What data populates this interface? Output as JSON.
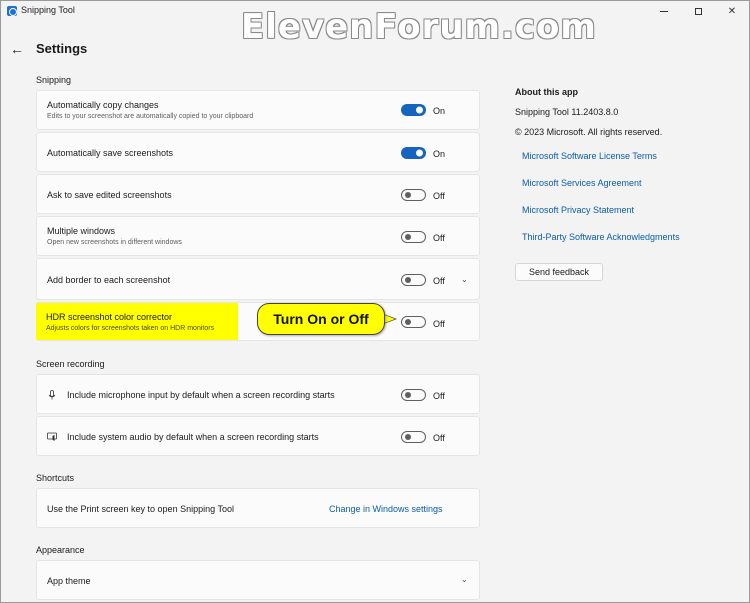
{
  "window": {
    "title": "Snipping Tool"
  },
  "watermark": "ElevenForum.com",
  "header": {
    "back_icon": "←",
    "title": "Settings"
  },
  "sections": {
    "snipping": "Snipping",
    "screen_recording": "Screen recording",
    "shortcuts": "Shortcuts",
    "appearance": "Appearance"
  },
  "snipping_items": [
    {
      "title": "Automatically copy changes",
      "desc": "Edits to your screenshot are automatically copied to your clipboard",
      "state": "On"
    },
    {
      "title": "Automatically save screenshots",
      "desc": "",
      "state": "On"
    },
    {
      "title": "Ask to save edited screenshots",
      "desc": "",
      "state": "Off"
    },
    {
      "title": "Multiple windows",
      "desc": "Open new screenshots in different windows",
      "state": "Off"
    },
    {
      "title": "Add border to each screenshot",
      "desc": "",
      "state": "Off"
    },
    {
      "title": "HDR screenshot color corrector",
      "desc": "Adjusts colors for screenshots taken on HDR monitors",
      "state": "Off"
    }
  ],
  "recording_items": [
    {
      "title": "Include microphone input by default when a screen recording starts",
      "state": "Off",
      "icon": "microphone-icon"
    },
    {
      "title": "Include system audio by default when a screen recording starts",
      "state": "Off",
      "icon": "speaker-icon"
    }
  ],
  "shortcuts_item": {
    "title": "Use the Print screen key to open Snipping Tool",
    "link": "Change in Windows settings"
  },
  "appearance_item": {
    "title": "App theme"
  },
  "callout": {
    "text": "Turn On or Off"
  },
  "about": {
    "title": "About this app",
    "version": "Snipping Tool 11.2403.8.0",
    "copyright": "© 2023 Microsoft. All rights reserved.",
    "links": [
      "Microsoft Software License Terms",
      "Microsoft Services Agreement",
      "Microsoft Privacy Statement",
      "Third-Party Software Acknowledgments"
    ],
    "feedback_button": "Send feedback"
  },
  "colors": {
    "accent": "#1564c0",
    "link": "#0b5cad",
    "highlight": "#ffff00"
  }
}
